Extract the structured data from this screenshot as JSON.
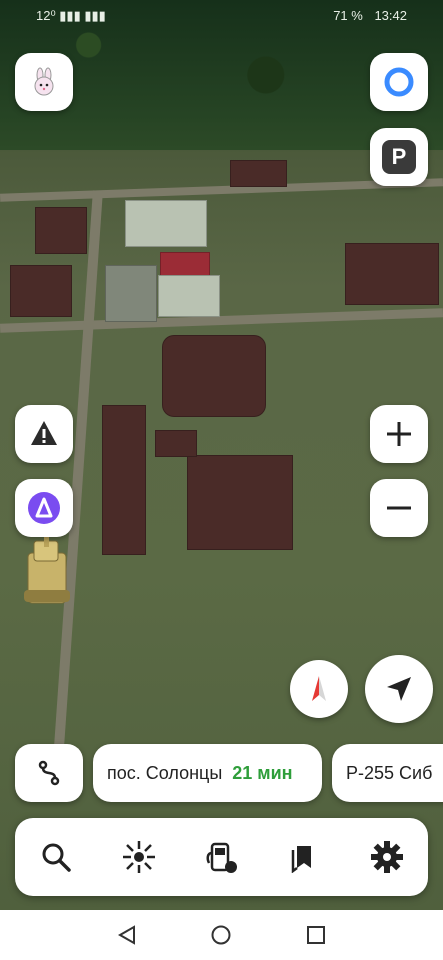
{
  "status_bar": {
    "left": "12⁰ ▮▮▮ ▮▮▮",
    "battery": "71 %",
    "time": "13:42"
  },
  "route_pills": [
    {
      "place": "пос. Солонцы",
      "time": "21 мин"
    },
    {
      "place": "Р-255 Сиб",
      "time": ""
    }
  ],
  "icons": {
    "alice_avatar": "bunny-icon",
    "alice_assistant": "alice-icon",
    "parking": "P",
    "compass": "compass-icon",
    "locate": "locate-arrow-icon",
    "route_switch": "route-switch-icon"
  },
  "toolbar": [
    {
      "name": "search-icon"
    },
    {
      "name": "layers-icon"
    },
    {
      "name": "fuel-icon"
    },
    {
      "name": "bookmarks-icon"
    },
    {
      "name": "gear-icon"
    }
  ],
  "colors": {
    "accent": "#2e9e3a",
    "alice_purple": "#7a4cf0",
    "compass_red": "#e53935"
  }
}
